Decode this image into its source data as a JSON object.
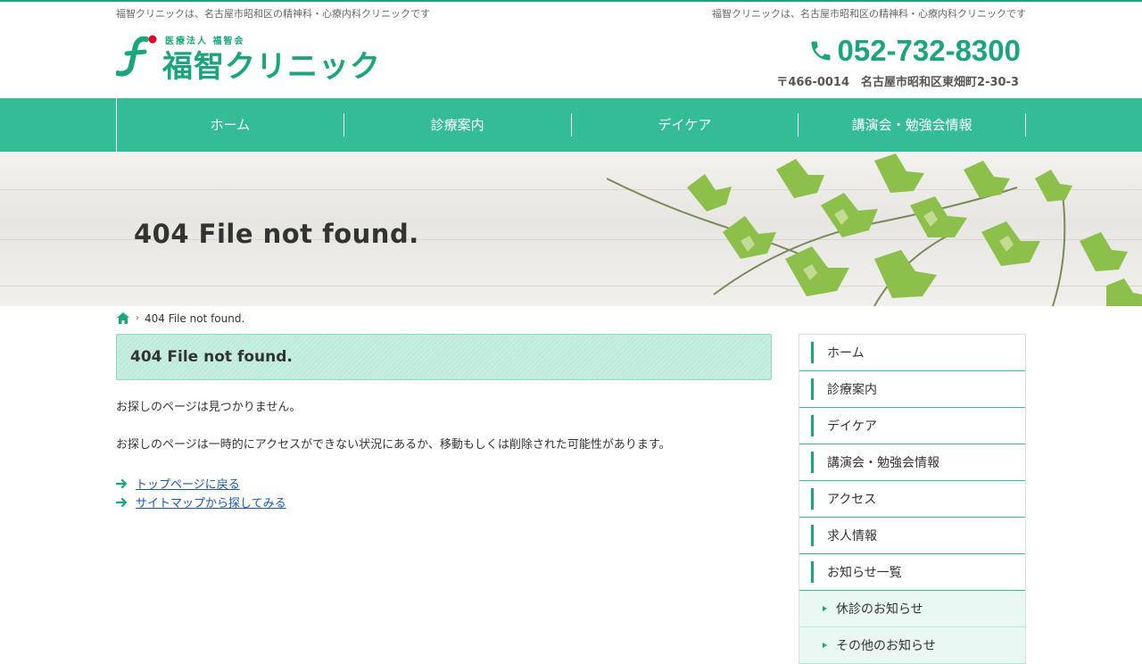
{
  "header": {
    "tagline_left": "福智クリニックは、名古屋市昭和区の精神科・心療内科クリニックです",
    "tagline_right": "福智クリニックは、名古屋市昭和区の精神科・心療内科クリニックです",
    "logo_sub": "医療法人 福智会",
    "logo_name": "福智クリニック",
    "phone": "052-732-8300",
    "address": "〒466-0014　名古屋市昭和区東畑町2-30-3"
  },
  "gnav": {
    "items": [
      "ホーム",
      "診療案内",
      "デイケア",
      "講演会・勉強会情報"
    ]
  },
  "hero": {
    "title": "404 File not found."
  },
  "breadcrumb": {
    "current": "404 File not found."
  },
  "main": {
    "heading": "404 File not found.",
    "message1": "お探しのページは見つかりません。",
    "message2": "お探しのページは一時的にアクセスができない状況にあるか、移動もしくは削除された可能性があります。",
    "links": [
      "トップページに戻る",
      "サイトマップから探してみる"
    ]
  },
  "sidebar": {
    "items": [
      "ホーム",
      "診療案内",
      "デイケア",
      "講演会・勉強会情報",
      "アクセス",
      "求人情報",
      "お知らせ一覧"
    ],
    "subitems": [
      "休診のお知らせ",
      "その他のお知らせ"
    ]
  },
  "colors": {
    "accent": "#1aa57d",
    "nav_bg": "#33bc95",
    "link": "#1a55b8",
    "logo_dot": "#e0002a"
  }
}
